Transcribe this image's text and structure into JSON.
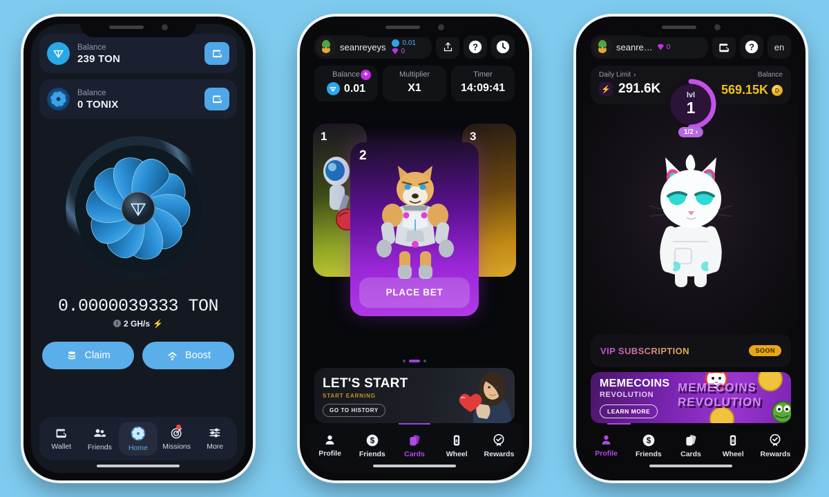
{
  "background_color": "#7ECBEF",
  "phone1": {
    "name": "tonix-miner-home",
    "balances": [
      {
        "icon": "ton-coin-icon",
        "label": "Balance",
        "value": "239 TON",
        "action_icon": "wallet-icon"
      },
      {
        "icon": "tonix-turbine-icon",
        "label": "Balance",
        "value": "0 TONIX",
        "action_icon": "wallet-icon"
      }
    ],
    "mined_amount": "0.0000039333  TON",
    "hashrate": "2 GH/s",
    "hashrate_bolt": "⚡",
    "actions": [
      {
        "label": "Claim",
        "icon": "coins-stack-icon"
      },
      {
        "label": "Boost",
        "icon": "boost-signal-icon"
      }
    ],
    "nav": [
      {
        "label": "Wallet",
        "icon": "wallet-icon",
        "active": false,
        "badge": false
      },
      {
        "label": "Friends",
        "icon": "friends-icon",
        "active": false,
        "badge": false
      },
      {
        "label": "Home",
        "icon": "turbine-icon",
        "active": true,
        "badge": false
      },
      {
        "label": "Missions",
        "icon": "target-icon",
        "active": false,
        "badge": true
      },
      {
        "label": "More",
        "icon": "sliders-icon",
        "active": false,
        "badge": false
      }
    ],
    "accent": "#5AAEEA"
  },
  "phone2": {
    "name": "cards-place-bet",
    "header": {
      "avatar_icon": "user-avatar-icon",
      "username": "seanreyeys",
      "ton_balance": "0.01",
      "gem_balance": "0",
      "buttons": [
        {
          "icon": "share-icon"
        },
        {
          "icon": "help-icon"
        },
        {
          "icon": "clock-icon"
        }
      ]
    },
    "stats": [
      {
        "label": "Balance",
        "value": "0.01",
        "icon": "ton-coin-icon",
        "plus": "+"
      },
      {
        "label": "Multiplier",
        "value": "X1"
      },
      {
        "label": "Timer",
        "value": "14:09:41"
      }
    ],
    "cards": [
      {
        "number": "1",
        "art": "astronaut-boxer-card",
        "position": "left"
      },
      {
        "number": "2",
        "art": "cyber-shiba-card",
        "position": "center",
        "cta": "PLACE BET"
      },
      {
        "number": "3",
        "art": "golden-card",
        "position": "right"
      }
    ],
    "pager": {
      "total": 3,
      "active": 2
    },
    "promo": {
      "title": "LET'S START",
      "subtitle": "START EARNING",
      "button": "GO TO HISTORY",
      "art": "man-with-heart-icon"
    },
    "nav": [
      {
        "label": "Profile",
        "icon": "profile-icon",
        "active": false
      },
      {
        "label": "Friends",
        "icon": "dollar-coin-icon",
        "active": false
      },
      {
        "label": "Cards",
        "icon": "cards-icon",
        "active": true
      },
      {
        "label": "Wheel",
        "icon": "wheel-icon",
        "active": false
      },
      {
        "label": "Rewards",
        "icon": "reward-check-icon",
        "active": false
      }
    ],
    "accent": "#b04ae8"
  },
  "phone3": {
    "name": "profile-cat-home",
    "header": {
      "avatar_icon": "user-avatar-icon",
      "username": "seanre…",
      "gem_balance": "0",
      "buttons": [
        {
          "icon": "wallet-icon"
        },
        {
          "icon": "help-icon"
        },
        {
          "label": "en",
          "icon": "language-selector"
        }
      ]
    },
    "daily_limit": {
      "label": "Daily Limit",
      "value": "291.6K",
      "icon": "bolt-icon",
      "chevron": "›"
    },
    "balance": {
      "label": "Balance",
      "value": "569.15K",
      "icon": "gold-coin-icon"
    },
    "level": {
      "label": "lvl",
      "value": "1",
      "progress": "1/2",
      "chevron": "›",
      "percent": 50
    },
    "character": "cyber-cat-icon",
    "vip": {
      "title": "VIP SUBSCRIPTION",
      "badge": "SOON"
    },
    "meme_banner": {
      "title": "MEMECOINS",
      "subtitle": "REVOLUTION",
      "button": "LEARN MORE",
      "art_line1": "MEMECOINS",
      "art_line2": "REVOLUTION"
    },
    "nav": [
      {
        "label": "Profile",
        "icon": "profile-icon",
        "active": true
      },
      {
        "label": "Friends",
        "icon": "dollar-coin-icon",
        "active": false
      },
      {
        "label": "Cards",
        "icon": "cards-icon",
        "active": false
      },
      {
        "label": "Wheel",
        "icon": "wheel-icon",
        "active": false
      },
      {
        "label": "Rewards",
        "icon": "reward-check-icon",
        "active": false
      }
    ],
    "accent": "#b04ae8"
  }
}
